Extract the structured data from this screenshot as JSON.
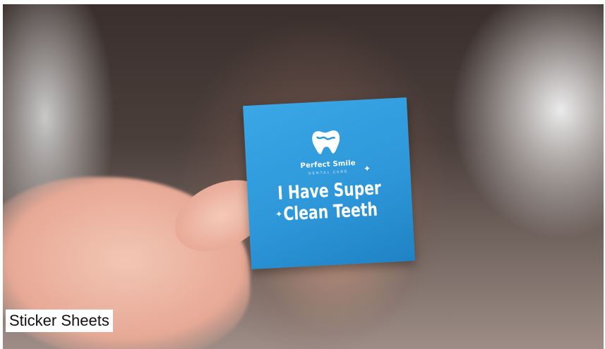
{
  "caption": "Sticker Sheets",
  "sticker": {
    "brand_name": "Perfect Smile",
    "brand_tagline": "DENTAL CARE",
    "headline_line1": "I Have Super",
    "headline_line2": "Clean Teeth"
  },
  "colors": {
    "sticker_blue": "#2d96d8",
    "label_bg": "#ffffff"
  }
}
